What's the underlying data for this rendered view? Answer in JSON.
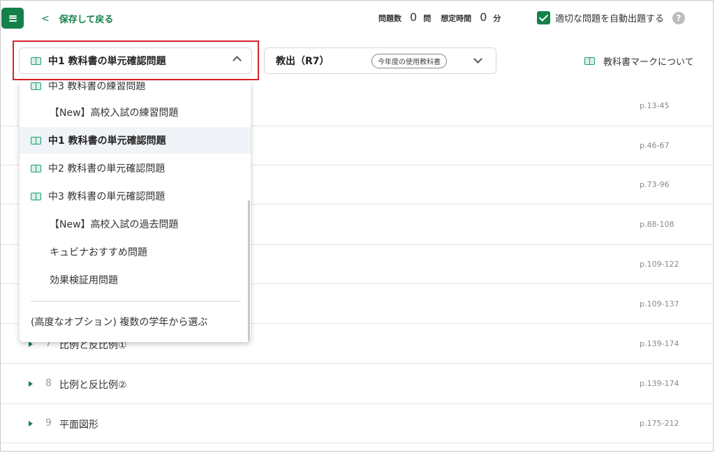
{
  "header": {
    "back_label": "保存して戻る",
    "question_count_label": "問題数",
    "question_count": "0",
    "question_unit": "問",
    "time_label": "想定時間",
    "time_value": "0",
    "time_unit": "分",
    "auto_label": "適切な問題を自動出題する",
    "auto_checked": true,
    "help_glyph": "?"
  },
  "selectors": {
    "grade_selected": "中1 教科書の単元確認問題",
    "textbook_selected": "教出（R7）",
    "textbook_pill": "今年度の使用教科書",
    "mark_about": "教科書マークについて"
  },
  "dropdown": {
    "items": [
      {
        "label": "中3 教科書の練習問題",
        "icon": "textbook-mark-icon",
        "selected": false
      },
      {
        "label": "【New】高校入試の練習問題",
        "icon": null,
        "selected": false
      },
      {
        "label": "中1 教科書の単元確認問題",
        "icon": "textbook-mark-icon",
        "selected": true
      },
      {
        "label": "中2 教科書の単元確認問題",
        "icon": "textbook-mark-icon",
        "selected": false
      },
      {
        "label": "中3 教科書の単元確認問題",
        "icon": "textbook-mark-icon",
        "selected": false
      },
      {
        "label": "【New】高校入試の過去問題",
        "icon": null,
        "selected": false
      },
      {
        "label": "キュビナおすすめ問題",
        "icon": null,
        "selected": false
      },
      {
        "label": "効果検証用問題",
        "icon": null,
        "selected": false
      }
    ],
    "advanced": "(高度なオプション) 複数の学年から選ぶ"
  },
  "chapters": [
    {
      "num": "",
      "name": "",
      "pages": "p.13-45"
    },
    {
      "num": "",
      "name": "",
      "pages": "p.46-67"
    },
    {
      "num": "",
      "name": "",
      "pages": "p.73-96"
    },
    {
      "num": "",
      "name": "",
      "pages": "p.88-108"
    },
    {
      "num": "",
      "name": "",
      "pages": "p.109-122"
    },
    {
      "num": "",
      "name": "",
      "pages": "p.109-137"
    },
    {
      "num": "7",
      "name": "比例と反比例①",
      "pages": "p.139-174"
    },
    {
      "num": "8",
      "name": "比例と反比例②",
      "pages": "p.139-174"
    },
    {
      "num": "9",
      "name": "平面図形",
      "pages": "p.175-212"
    }
  ],
  "colors": {
    "brand": "#14804a",
    "highlight": "#d7222a",
    "icon": "#1d9b78"
  }
}
